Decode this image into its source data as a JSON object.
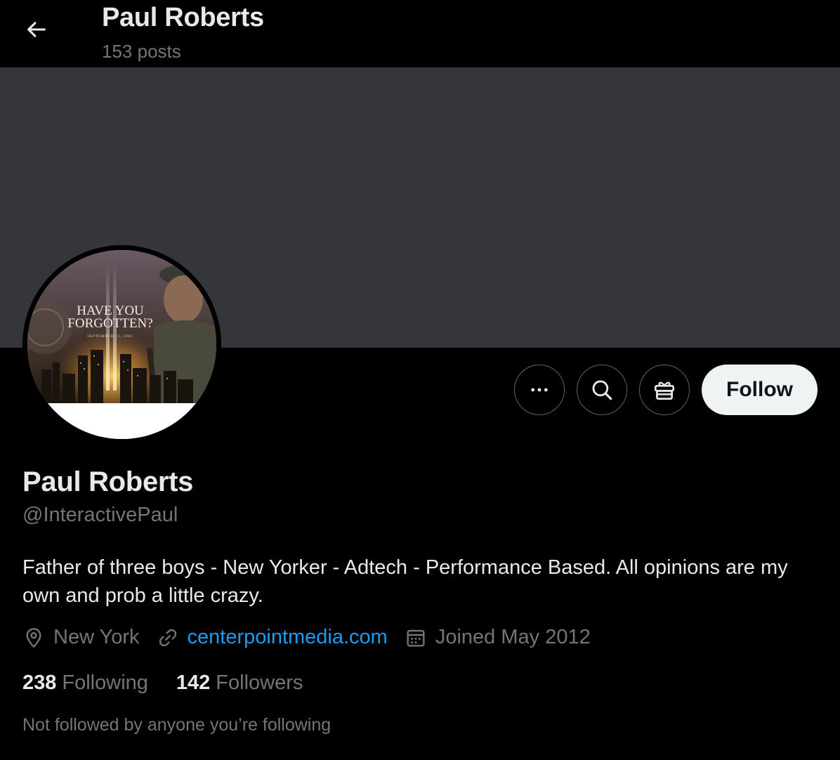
{
  "header": {
    "title": "Paul Roberts",
    "post_count": "153 posts"
  },
  "avatar": {
    "poster_line1": "HAVE YOU",
    "poster_line2": "FORGOTTEN?",
    "poster_date": "SEPTEMBER 11, 2001"
  },
  "actions": {
    "more_icon": "more-icon",
    "search_icon": "search-icon",
    "gift_icon": "gift-icon",
    "follow_label": "Follow"
  },
  "profile": {
    "name": "Paul Roberts",
    "handle": "@InteractivePaul",
    "bio": "Father of three boys - New Yorker - Adtech - Performance Based. All opinions are my own and prob a little crazy.",
    "location": "New York",
    "website": "centerpointmedia.com",
    "joined": "Joined May 2012"
  },
  "stats": {
    "following_count": "238",
    "following_label": "Following",
    "followers_count": "142",
    "followers_label": "Followers"
  },
  "social_context": "Not followed by anyone you’re following",
  "colors": {
    "background": "#000000",
    "banner": "#35363b",
    "link": "#1d9bf0",
    "muted": "#71767b",
    "follow_button": "#eff3f4"
  }
}
